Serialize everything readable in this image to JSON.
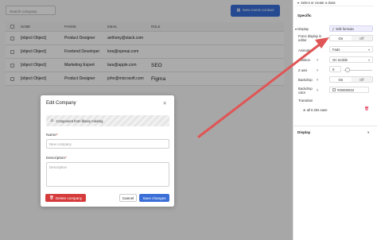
{
  "search": {
    "placeholder": "Search company"
  },
  "new_button": {
    "label": "New event contact",
    "icon": "calendar-icon"
  },
  "table": {
    "headers": [
      "NAME",
      "PHONE",
      "EMAIL",
      "ROLE"
    ],
    "rows": [
      {
        "name": "[object Object]",
        "phone": "Product Designer",
        "email": "anthony@slack.com",
        "role": ""
      },
      {
        "name": "[object Object]",
        "phone": "Frontend Developer",
        "email": "lora@openai.com",
        "role": ""
      },
      {
        "name": "[object Object]",
        "phone": "Marketing Expert",
        "email": "lara@apple.com",
        "role": "SEO"
      },
      {
        "name": "[object Object]",
        "phone": "Product Designer",
        "email": "john@microsoft.com",
        "role": "Figma"
      }
    ]
  },
  "modal": {
    "title": "Edit Company",
    "warning": "Component from library missing",
    "name_label": "Name",
    "name_placeholder": "New company",
    "description_label": "Description",
    "description_placeholder": "Description",
    "delete_label": "Delete company",
    "cancel_label": "Cancel",
    "save_label": "Save changes"
  },
  "panel": {
    "class_selector": "Select or create a class",
    "specific_heading": "Specific",
    "display_label": "Display",
    "display_value": "Edit formula",
    "force_display_label": "Force display in editor",
    "force_on": "On",
    "force_off": "Off",
    "animation_label": "Animation",
    "animation_value": "Fade",
    "position_label": "Position",
    "position_value": "On mobile",
    "zaxis_label": "Z axis",
    "zaxis_value": "0",
    "backdrop_label": "Backdrop",
    "backdrop_on": "On",
    "backdrop_off": "Off",
    "backdrop_color_label": "Backdrop color",
    "backdrop_color_value": "#00000033",
    "transition_label": "Transition",
    "transition_value": "all 0.25s ease",
    "display_section": "Display"
  },
  "colors": {
    "accent": "#3a6fd8",
    "danger": "#d63b3b",
    "arrow": "#e05555"
  }
}
